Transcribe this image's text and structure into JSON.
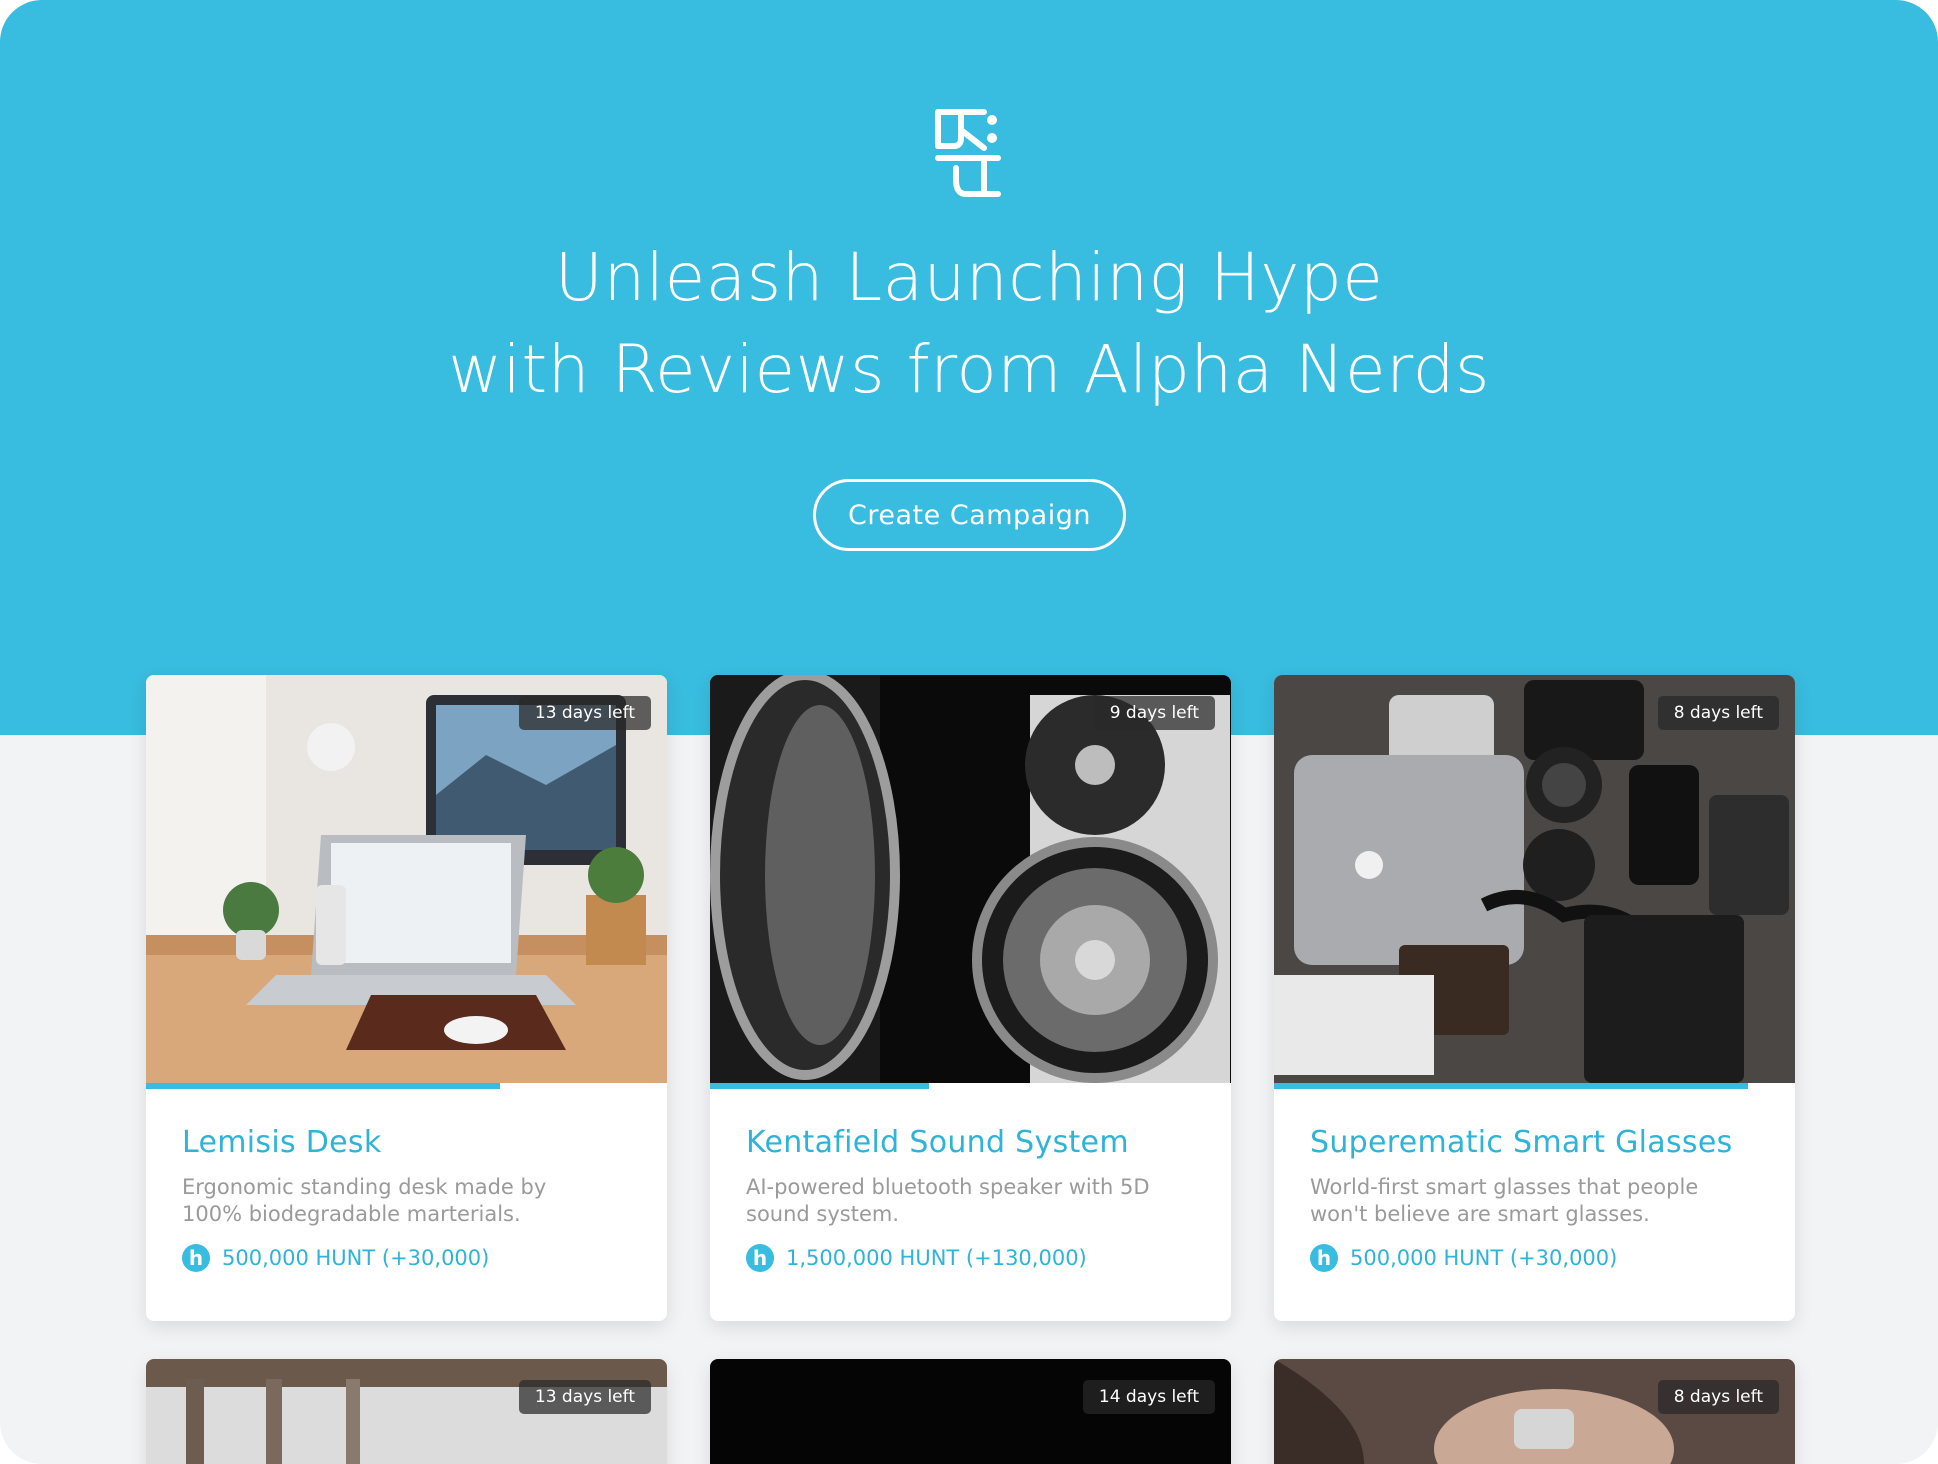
{
  "hero": {
    "headline_line1": "Unleash Launching Hype",
    "headline_line2": "with Reviews from Alpha Nerds",
    "cta_label": "Create Campaign"
  },
  "colors": {
    "accent": "#38bcdf",
    "title": "#2fb3d8",
    "muted": "#9a9a9a"
  },
  "cards": [
    {
      "badge": "13 days left",
      "title": "Lemisis Desk",
      "desc": "Ergonomic standing desk made by 100% biodegradable marterials.",
      "reward": "500,000 HUNT (+30,000)",
      "progress": 0.68,
      "image": "desk-workspace-photo"
    },
    {
      "badge": "9 days left",
      "title": "Kentafield Sound System",
      "desc": "AI-powered bluetooth speaker with 5D sound system.",
      "reward": "1,500,000 HUNT (+130,000)",
      "progress": 0.42,
      "image": "speaker-photo"
    },
    {
      "badge": "8 days left",
      "title": "Superematic Smart Glasses",
      "desc": "World-first smart glasses that people won't believe are smart glasses.",
      "reward": "500,000 HUNT (+30,000)",
      "progress": 0.91,
      "image": "gadgets-flatlay-photo"
    },
    {
      "badge": "13 days left",
      "image": "wooden-beams-photo"
    },
    {
      "badge": "14 days left",
      "image": "dark-photo"
    },
    {
      "badge": "8 days left",
      "image": "hands-phone-photo"
    }
  ],
  "icons": {
    "logo": "rh-logo-icon",
    "hunt": "hunt-coin-icon"
  }
}
